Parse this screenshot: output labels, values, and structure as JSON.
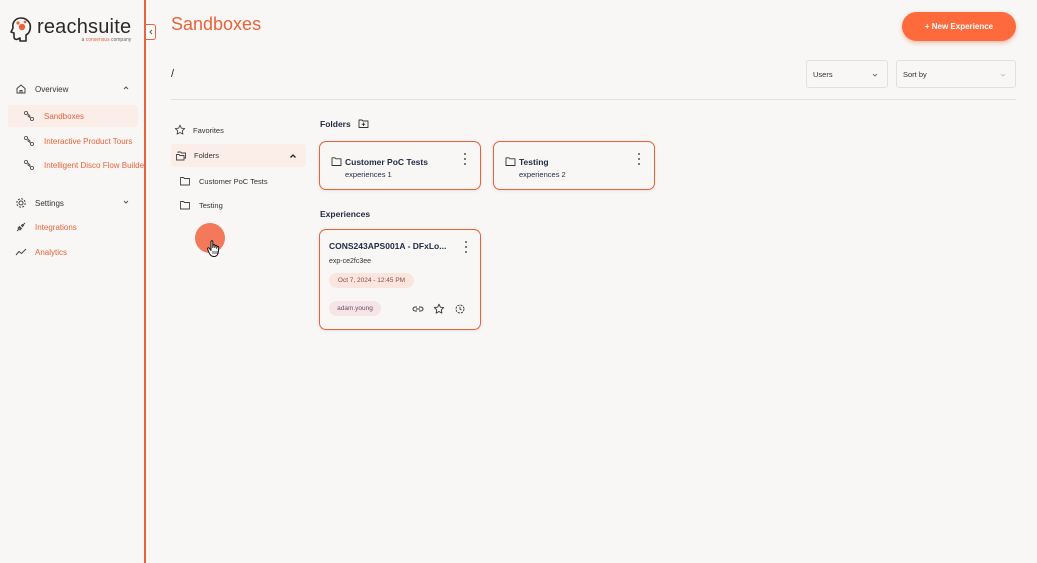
{
  "brand": {
    "name": "reachsuite",
    "tagline_prefix": "a ",
    "tagline_mid": "consensus",
    "tagline_suffix": " company",
    "accent": "#e8633a"
  },
  "sidebar": {
    "groups": [
      {
        "label": "Overview",
        "icon": "home-icon",
        "expanded": true
      },
      {
        "label": "Settings",
        "icon": "gear-icon",
        "expanded": false
      }
    ],
    "items": [
      {
        "label": "Sandboxes",
        "icon": "flow-icon",
        "active": true
      },
      {
        "label": "Interactive Product Tours",
        "icon": "flow-icon"
      },
      {
        "label": "Intelligent Disco Flow Builder",
        "icon": "flow-icon"
      }
    ],
    "links": [
      {
        "label": "Integrations",
        "icon": "plug-icon"
      },
      {
        "label": "Analytics",
        "icon": "trend-icon"
      }
    ]
  },
  "header": {
    "title": "Sandboxes",
    "new_button": "+ New Experience",
    "breadcrumb": "/",
    "users_filter": "Users",
    "sort_by": "Sort by"
  },
  "tree": {
    "favorites": "Favorites",
    "folders": "Folders",
    "children": [
      "Customer PoC Tests",
      "Testing"
    ]
  },
  "sections": {
    "folders_title": "Folders",
    "experiences_title": "Experiences"
  },
  "folders": [
    {
      "name": "Customer PoC Tests",
      "count": "experiences 1"
    },
    {
      "name": "Testing",
      "count": "experiences 2"
    }
  ],
  "experiences": [
    {
      "name": "CONS243APS001A - DFxLo...",
      "id": "exp-ce2fc3ee",
      "date": "Oct 7, 2024 - 12:45 PM",
      "owner": "adam.young"
    }
  ]
}
